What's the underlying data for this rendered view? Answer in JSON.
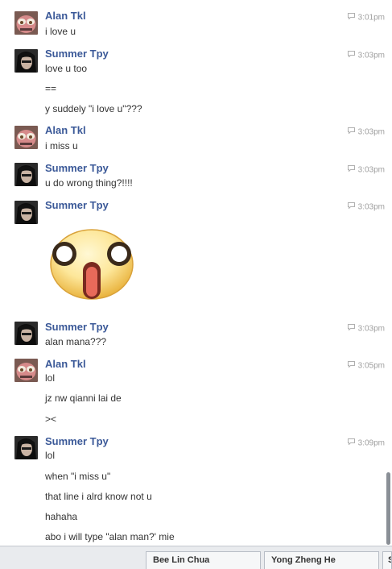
{
  "messages": [
    {
      "sender": "Alan Tkl",
      "avatar": "alan-avatar",
      "time": "3:01pm",
      "lines": [
        "i love u"
      ]
    },
    {
      "sender": "Summer Tpy",
      "avatar": "summer-avatar",
      "time": "3:03pm",
      "lines": [
        "love u too",
        "==",
        "y suddely \"i love u\"???"
      ]
    },
    {
      "sender": "Alan Tkl",
      "avatar": "alan-avatar",
      "time": "3:03pm",
      "lines": [
        "i miss u"
      ]
    },
    {
      "sender": "Summer Tpy",
      "avatar": "summer-avatar",
      "time": "3:03pm",
      "lines": [
        "u do wrong thing?!!!!"
      ]
    },
    {
      "sender": "Summer Tpy",
      "avatar": "summer-avatar",
      "time": "3:03pm",
      "sticker": "shocked-face-sticker"
    },
    {
      "sender": "Summer Tpy",
      "avatar": "summer-avatar",
      "time": "3:03pm",
      "lines": [
        "alan mana???"
      ]
    },
    {
      "sender": "Alan Tkl",
      "avatar": "alan-avatar",
      "time": "3:05pm",
      "lines": [
        "lol",
        "jz nw qianni lai de",
        "><"
      ]
    },
    {
      "sender": "Summer Tpy",
      "avatar": "summer-avatar",
      "time": "3:09pm",
      "lines": [
        "lol",
        "when \"i miss u\"",
        "that line i alrd know not u",
        "hahaha",
        "abo i will type \"alan man?' mie"
      ]
    }
  ],
  "dock": {
    "tabs": [
      "Bee Lin Chua",
      "Yong Zheng He",
      "S"
    ]
  },
  "icons": {
    "timestamp": "chat-bubble-icon"
  }
}
